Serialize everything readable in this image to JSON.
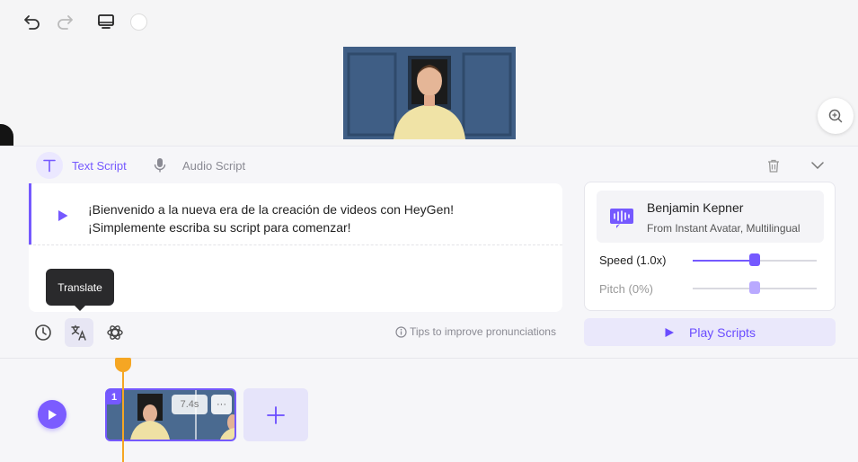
{
  "toolbar": {
    "undo_icon": "undo-icon",
    "redo_icon": "redo-icon",
    "monitor_icon": "monitor-icon",
    "color_icon": "background-color-swatch"
  },
  "script_panel": {
    "tabs": [
      {
        "label": "Text Script",
        "icon": "text-icon",
        "active": true
      },
      {
        "label": "Audio Script",
        "icon": "microphone-icon",
        "active": false
      }
    ],
    "script_lines": [
      "¡Bienvenido a la nueva era de la creación de videos con HeyGen!",
      "¡Simplemente escriba su script para comenzar!"
    ],
    "tooltip": "Translate",
    "tips": "Tips to improve pronunciations"
  },
  "voice": {
    "name": "Benjamin Kepner",
    "source": "From Instant Avatar, Multilingual",
    "speed_label": "Speed (1.0x)",
    "speed_value": 0.5,
    "pitch_label": "Pitch (0%)",
    "pitch_value": 0.5,
    "play_label": "Play Scripts"
  },
  "timeline": {
    "clip_number": "1",
    "clip_duration": "7.4s",
    "clip_more": "···"
  },
  "colors": {
    "accent": "#7559ff",
    "playhead": "#f5a623"
  }
}
